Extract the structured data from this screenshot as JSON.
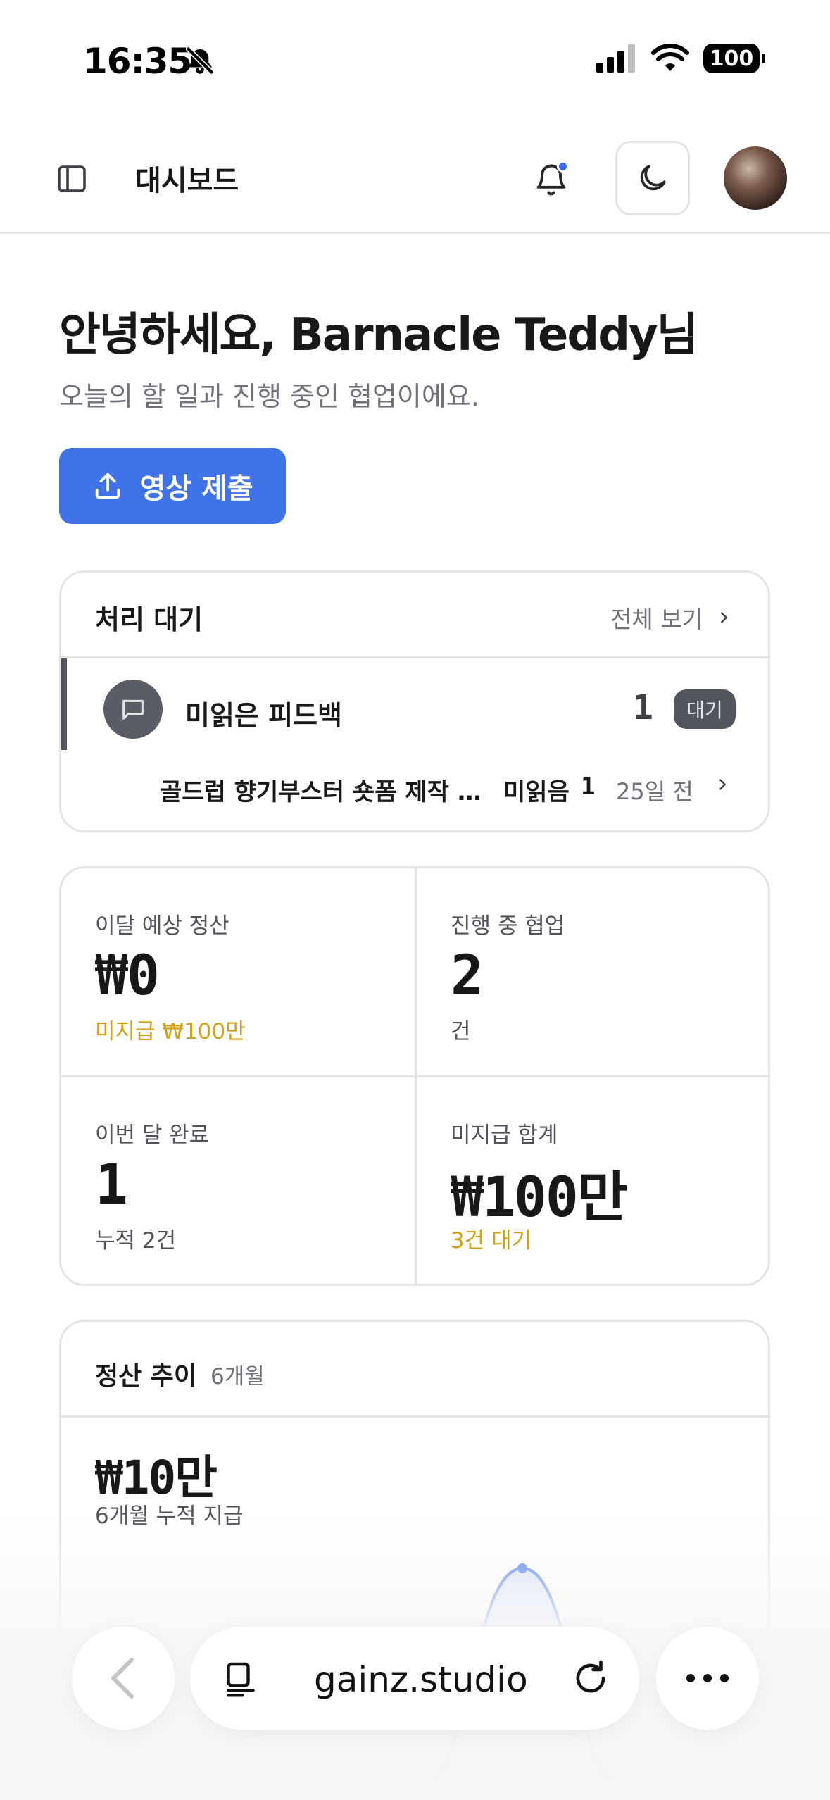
{
  "status_bar": {
    "time": "16:35",
    "battery": "100"
  },
  "header": {
    "title": "대시보드"
  },
  "greeting": {
    "title": "안녕하세요, Barnacle Teddy님",
    "subtitle": "오늘의 할 일과 진행 중인 협업이에요.",
    "submit_label": "영상 제출"
  },
  "pending": {
    "title": "처리 대기",
    "view_all": "전체 보기",
    "group": {
      "label": "미읽은 피드백",
      "count": "1",
      "badge": "대기"
    },
    "item": {
      "title": "골드럽 향기부스터 숏폼 제작 …",
      "unread_label": "미읽음",
      "unread_count": "1",
      "time": "25일 전"
    }
  },
  "stats": [
    {
      "label": "이달 예상 정산",
      "value": "₩0",
      "sub": "미지급 ₩100만",
      "sub_warn": true
    },
    {
      "label": "진행 중 협업",
      "value": "2",
      "sub": "건",
      "sub_warn": false
    },
    {
      "label": "이번 달 완료",
      "value": "1",
      "sub": "누적 2건",
      "sub_warn": false
    },
    {
      "label": "미지급 합계",
      "value": "₩100만",
      "sub": "3건 대기",
      "sub_warn": true
    }
  ],
  "trend": {
    "title": "정산 추이",
    "range": "6개월",
    "total": "₩10만",
    "caption": "6개월 누적 지급"
  },
  "chart_data": {
    "type": "area",
    "x": [
      "1",
      "2",
      "3",
      "4",
      "5",
      "6"
    ],
    "values": [
      0,
      0,
      0,
      100000,
      0,
      0
    ],
    "color": "#4072e8"
  },
  "browser": {
    "url": "gainz.studio"
  },
  "colors": {
    "accent": "#4072e8",
    "warning": "#d4a017",
    "border": "#e4e4e7"
  }
}
